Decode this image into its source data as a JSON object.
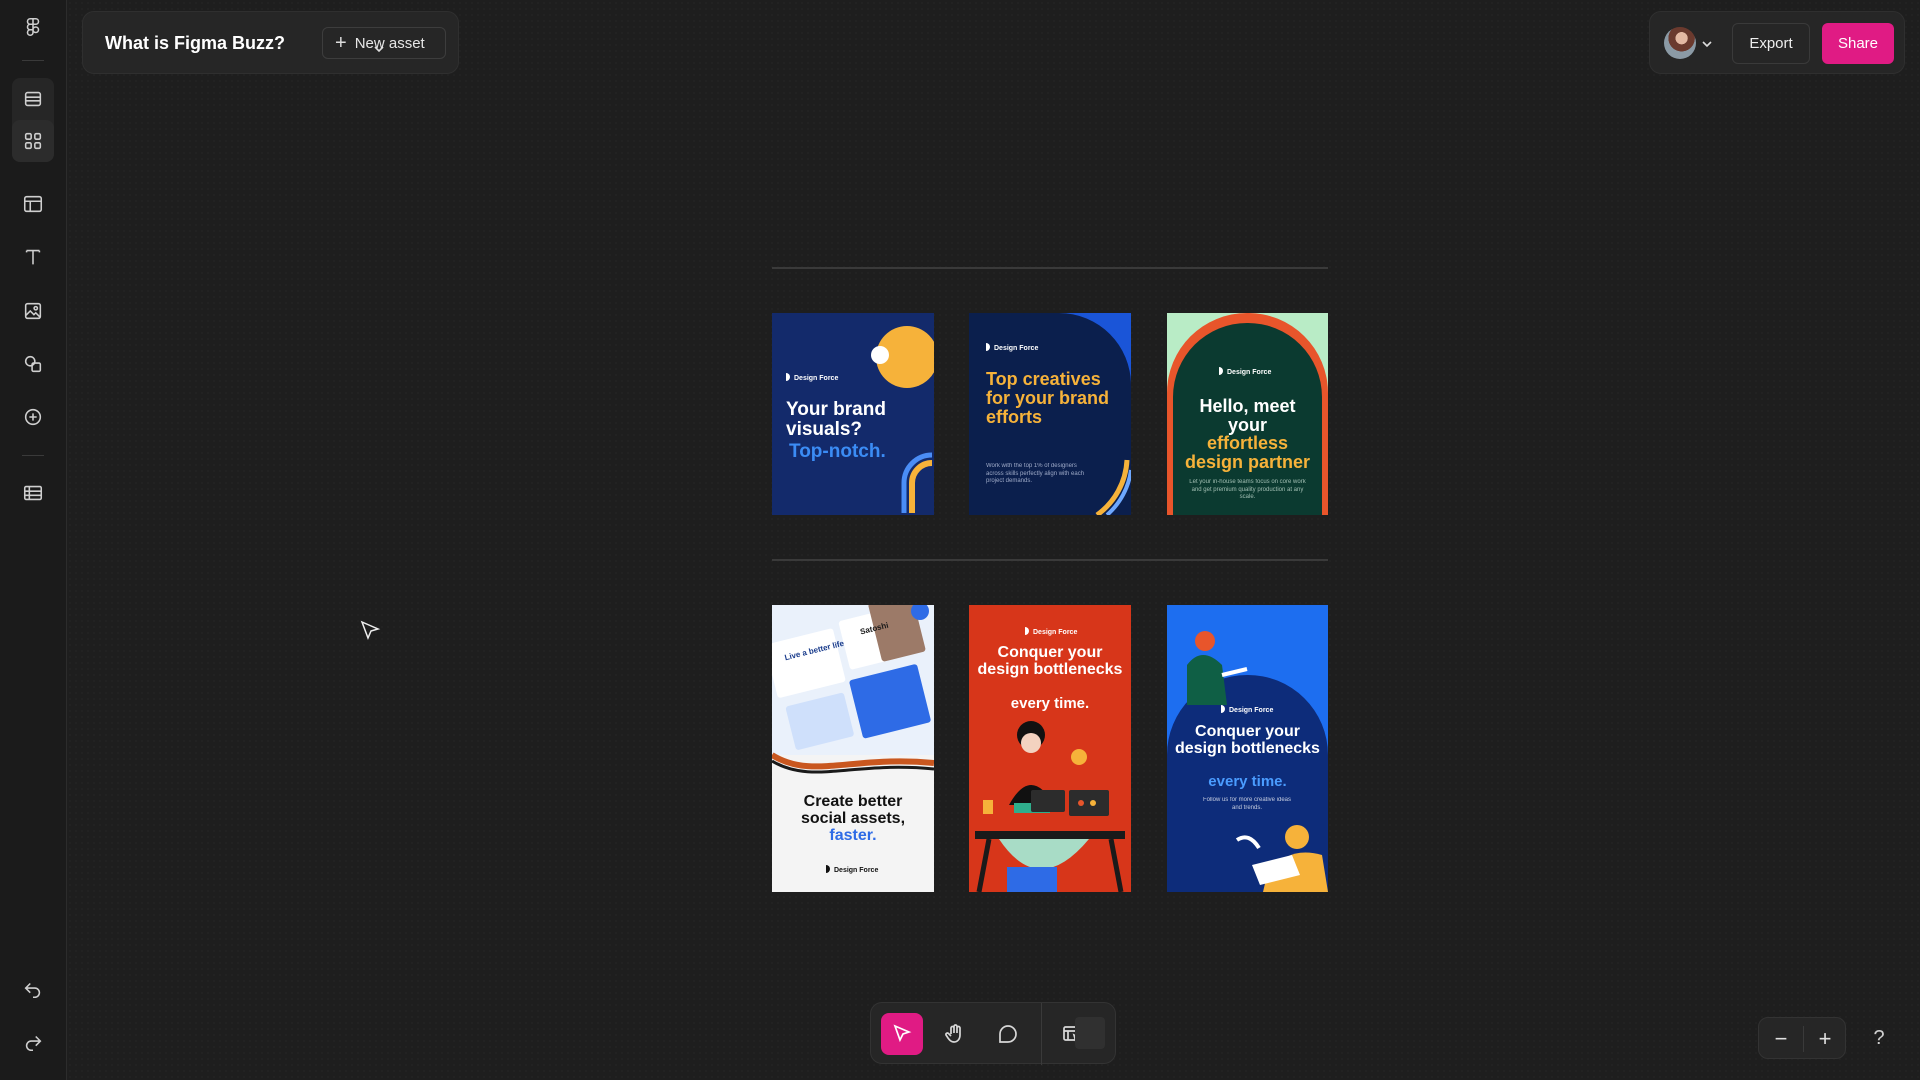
{
  "app": {
    "name": "Figma Buzz"
  },
  "document": {
    "title": "What is Figma Buzz?",
    "new_asset_label": "New asset"
  },
  "header": {
    "export_label": "Export",
    "share_label": "Share"
  },
  "rail": {
    "icons": [
      "figma-logo-icon",
      "list-view-icon",
      "grid-view-icon",
      "layout-icon",
      "text-icon",
      "image-icon",
      "shapes-icon",
      "add-icon",
      "table-icon",
      "undo-icon",
      "redo-icon"
    ]
  },
  "cards": [
    {
      "brand": "Design Force",
      "headline": "Your brand visuals?",
      "accent": "Top-notch.",
      "bg": "#132a6b"
    },
    {
      "brand": "Design Force",
      "headline": "Top creatives for your brand efforts",
      "body": "Work with the top 1% of designers across skills perfectly align with each project demands.",
      "bg": "#0b1f4d"
    },
    {
      "brand": "Design Force",
      "headline": "Hello, meet your",
      "accent": "effortless design partner",
      "body": "Let your in-house teams focus on core work and get premium quality production at any scale.",
      "bg": "#0b3a30"
    },
    {
      "brand": "Design Force",
      "headline": "Create better social assets,",
      "accent": "faster.",
      "mock_texts": [
        "Live a better life",
        "Satoshi"
      ],
      "bg": "#f4f4f4"
    },
    {
      "brand": "Design Force",
      "headline": "Conquer your design bottlenecks",
      "accent": "every time.",
      "bg": "#d7361a"
    },
    {
      "brand": "Design Force",
      "headline": "Conquer your design bottlenecks",
      "accent": "every time.",
      "body": "Follow us for more creative ideas and trends.",
      "bg": "#0d2c7a"
    }
  ],
  "toolbar": {
    "tools": [
      "move-tool",
      "hand-tool",
      "comment-tool",
      "actions-tool"
    ],
    "active": "move-tool"
  },
  "zoom": {
    "minus": "−",
    "plus": "+"
  },
  "help": {
    "label": "?"
  },
  "colors": {
    "accent": "#e01b84",
    "background": "#1e1e1e",
    "panel": "#262626"
  }
}
